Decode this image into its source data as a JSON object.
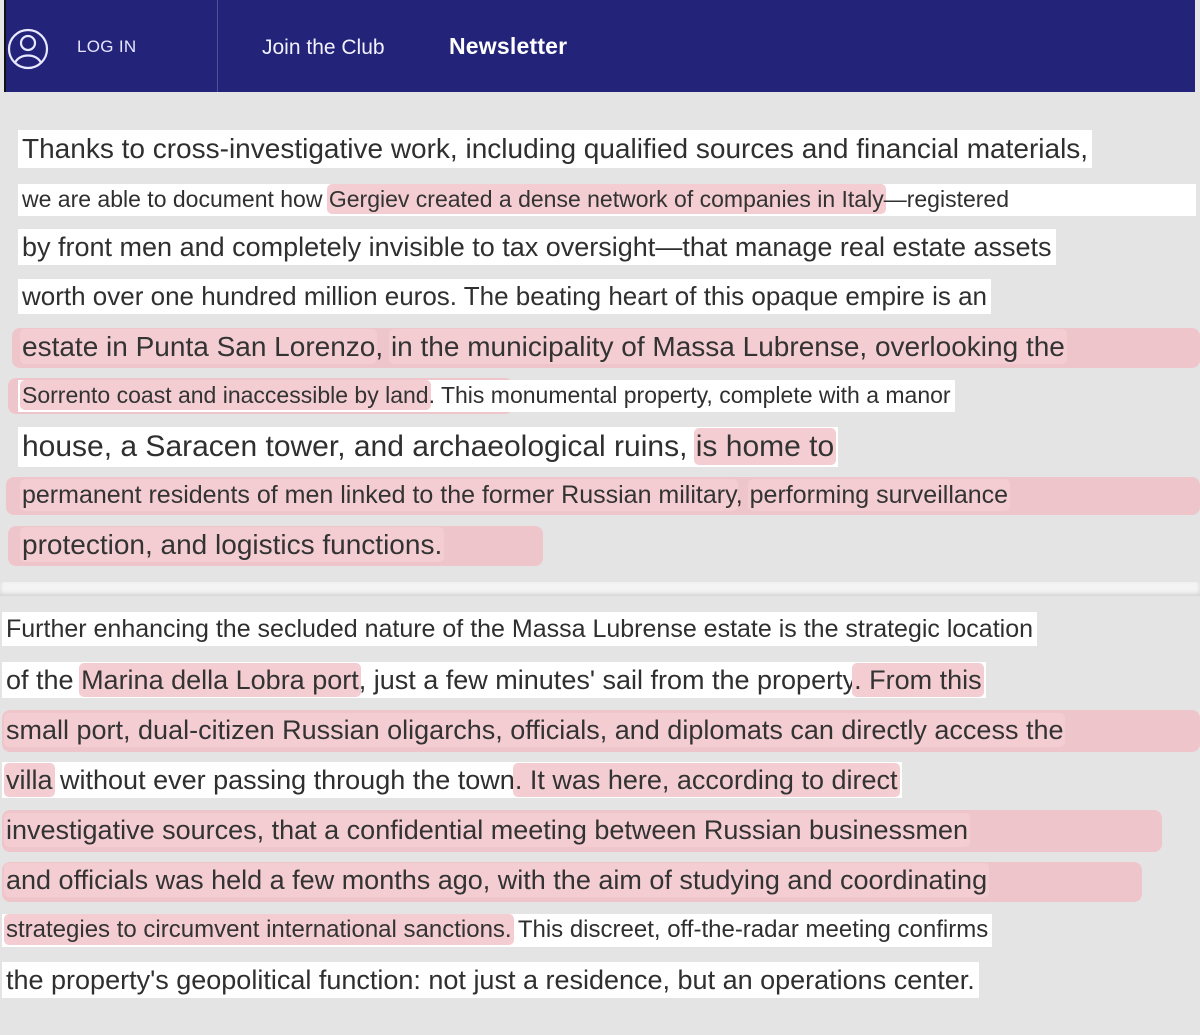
{
  "header": {
    "login_label": "LOG IN",
    "join_label": "Join the Club",
    "newsletter_label": "Newsletter",
    "bar_color": "#23237a",
    "user_icon": "user-icon"
  },
  "article_top": {
    "l1": "Thanks to cross-investigative work, including qualified sources and financial materials,",
    "l2a": "we are able to document how ",
    "l2b": "Gergiev created a dense network of companies in Italy",
    "l2c": "—registered",
    "l3": "by front men and completely invisible to tax oversight—that manage real estate assets",
    "l4": "worth over one hundred million euros. The beating heart of this opaque empire is an",
    "l5a": "estate in Punta San Lorenzo",
    "l5b": ", ",
    "l5c": "in the municipality of Massa Lubrense, overlooking the",
    "l6a": "Sorrento coast and inaccessible by land",
    "l6b": ". This monumental property, complete with a manor",
    "l7a": "house, a Saracen tower, and archaeological ruins, ",
    "l7b": "is home to",
    "l8a": "permanent residents of men linked to the former Russian military",
    "l8b": ", ",
    "l8c": "performing surveillance",
    "l9": "protection, and logistics functions."
  },
  "article_bottom": {
    "l1": "Further enhancing the secluded nature of the Massa Lubrense estate is the strategic location",
    "l2a": "of the ",
    "l2b": "Marina della Lobra port",
    "l2c": ", just a few minutes' sail from the property",
    "l2d": ". From this",
    "l3": "small port, dual-citizen Russian oligarchs, officials, and diplomats can directly access the",
    "l4a": "villa",
    "l4b": " without ever passing through the town",
    "l4c": ". It was here, according to direct",
    "l5": "investigative sources, that a confidential meeting between Russian businessmen",
    "l6": "and officials was held a few months ago, with the aim of studying and coordinating",
    "l7a": "strategies to circumvent international sanctions.",
    "l7b": " This discreet, off-the-radar meeting confirms",
    "l8": "the property's geopolitical function: not just a residence, but an operations center."
  },
  "colors": {
    "highlight": "#f3cdd1",
    "text": "#2f2f2f"
  }
}
